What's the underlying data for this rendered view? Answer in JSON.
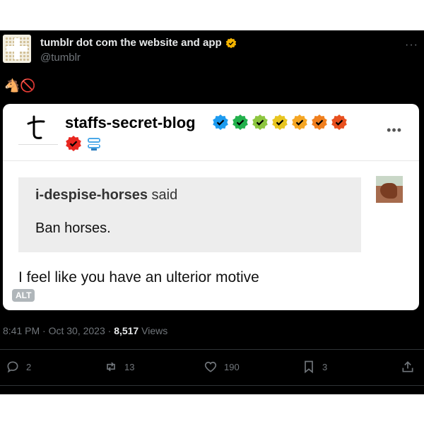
{
  "author": {
    "name": "tumblr dot com the website and app",
    "handle": "@tumblr",
    "verified_color": "#f4b400"
  },
  "tweet_emoji": "🐴🚫",
  "card": {
    "blog_name": "staffs-secret-blog",
    "badge_colors": [
      "#1d9bf0",
      "#22b14c",
      "#8dc63f",
      "#e8c51f",
      "#f5a623",
      "#f07f1e",
      "#e8501f"
    ],
    "badge_row2_color": "#e8261f",
    "reblog_user": "i-despise-horses",
    "reblog_said": "said",
    "reblog_text": "Ban horses.",
    "reply_text": "I feel like you have an ulterior motive",
    "alt_label": "ALT"
  },
  "meta": {
    "time": "8:41 PM · Oct 30, 2023 · ",
    "views_count": "8,517",
    "views_label": "Views"
  },
  "actions": {
    "replies": "2",
    "reposts": "13",
    "likes": "190",
    "bookmarks": "3"
  }
}
